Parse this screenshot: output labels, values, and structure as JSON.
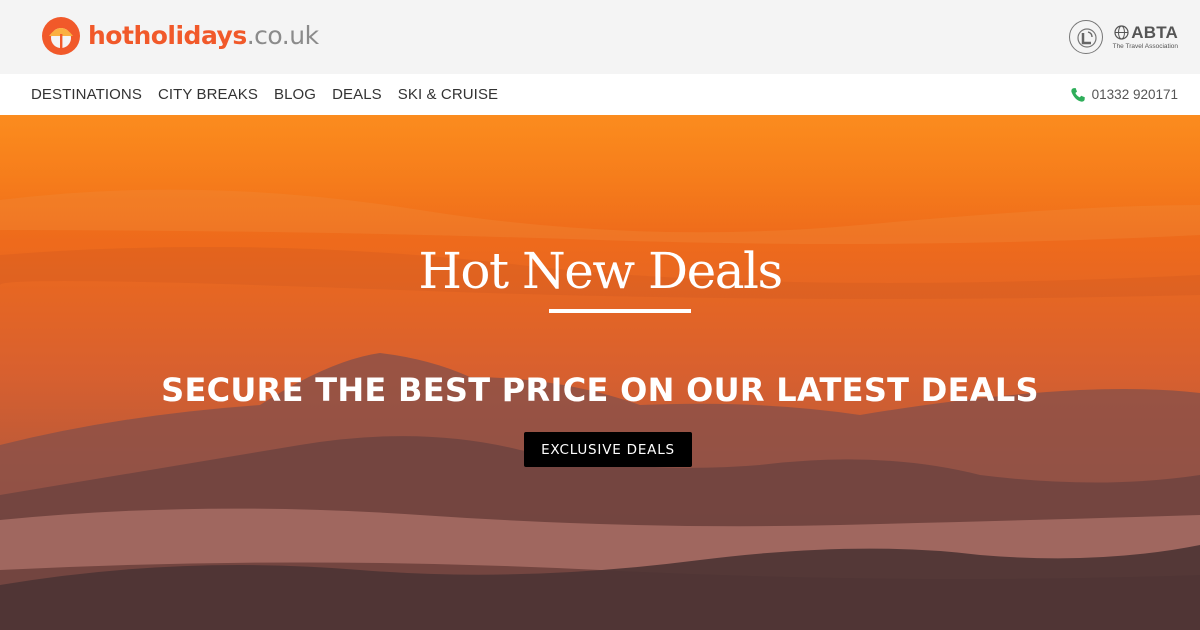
{
  "brand": {
    "logo_parts": {
      "hot": "hot",
      "holidays": "holidays",
      "tld": ".co.uk"
    },
    "accent_color": "#f1592a"
  },
  "badges": {
    "atol_icon": "atol-protected-icon",
    "abta_name": "ABTA",
    "abta_sub": "The Travel Association"
  },
  "nav": {
    "items": [
      "DESTINATIONS",
      "CITY BREAKS",
      "BLOG",
      "DEALS",
      "SKI & CRUISE"
    ]
  },
  "contact": {
    "phone_icon": "phone-icon",
    "phone_color": "#2fae5a",
    "phone_number": "01332 920171"
  },
  "hero": {
    "title": "Hot New Deals",
    "subtitle": "SECURE THE BEST PRICE ON OUR LATEST DEALS",
    "cta_label": "EXCLUSIVE DEALS",
    "background": "orange sunset sky over misty mountain ridges"
  }
}
